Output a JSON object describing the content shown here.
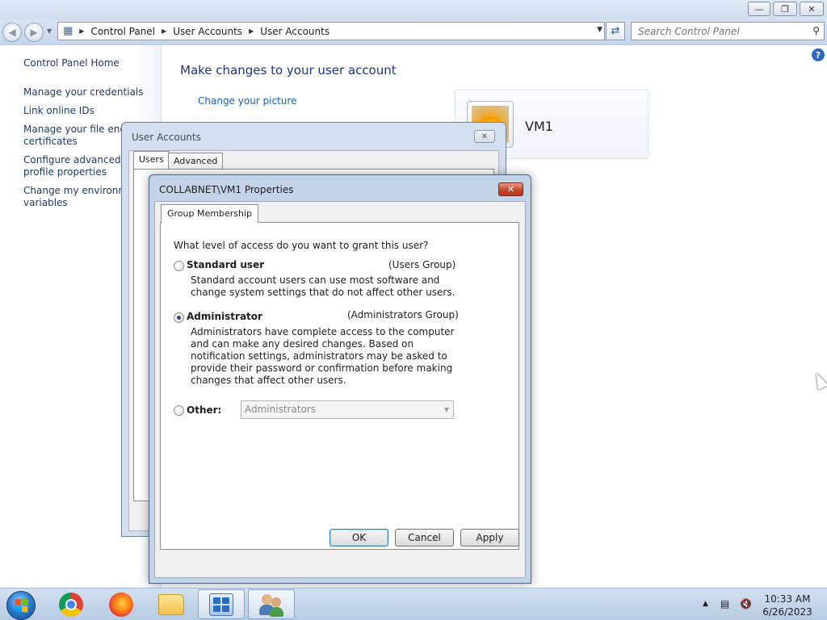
{
  "window": {
    "address": {
      "crumbs": [
        "Control Panel",
        "User Accounts",
        "User Accounts"
      ],
      "search_placeholder": "Search Control Panel"
    },
    "left_pane": {
      "links": [
        "Control Panel Home",
        "Manage your credentials",
        "Link online IDs",
        "Manage your file encry\ncertificates",
        "Configure advanced us\nprofile properties",
        "Change my environme\nvariables"
      ]
    },
    "main": {
      "title": "Make changes to your user account",
      "change_picture": "Change your picture",
      "user_name": "VM1"
    }
  },
  "user_accounts_dialog": {
    "title": "User Accounts",
    "tabs": [
      "Users",
      "Advanced"
    ]
  },
  "properties_dialog": {
    "title": "COLLABNET\\VM1 Properties",
    "tab": "Group Membership",
    "question": "What level of access do you want to grant this user?",
    "options": [
      {
        "label": "Standard user",
        "group": "(Users Group)",
        "description": "Standard account users can use most software and change system settings that do not affect other users.",
        "checked": false
      },
      {
        "label": "Administrator",
        "group": "(Administrators Group)",
        "description": "Administrators have complete access to the computer and can make any desired changes. Based on notification settings, administrators may be asked to provide their password or confirmation before making changes that affect other users.",
        "checked": true
      }
    ],
    "other": {
      "label": "Other:",
      "value": "Administrators",
      "checked": false
    },
    "buttons": {
      "ok": "OK",
      "cancel": "Cancel",
      "apply": "Apply"
    }
  },
  "taskbar": {
    "apps": [
      "chrome-icon",
      "firefox-icon",
      "explorer-icon",
      "control-panel-icon",
      "user-accounts-icon"
    ],
    "clock": {
      "time": "10:33 AM",
      "date": "6/26/2023"
    }
  }
}
